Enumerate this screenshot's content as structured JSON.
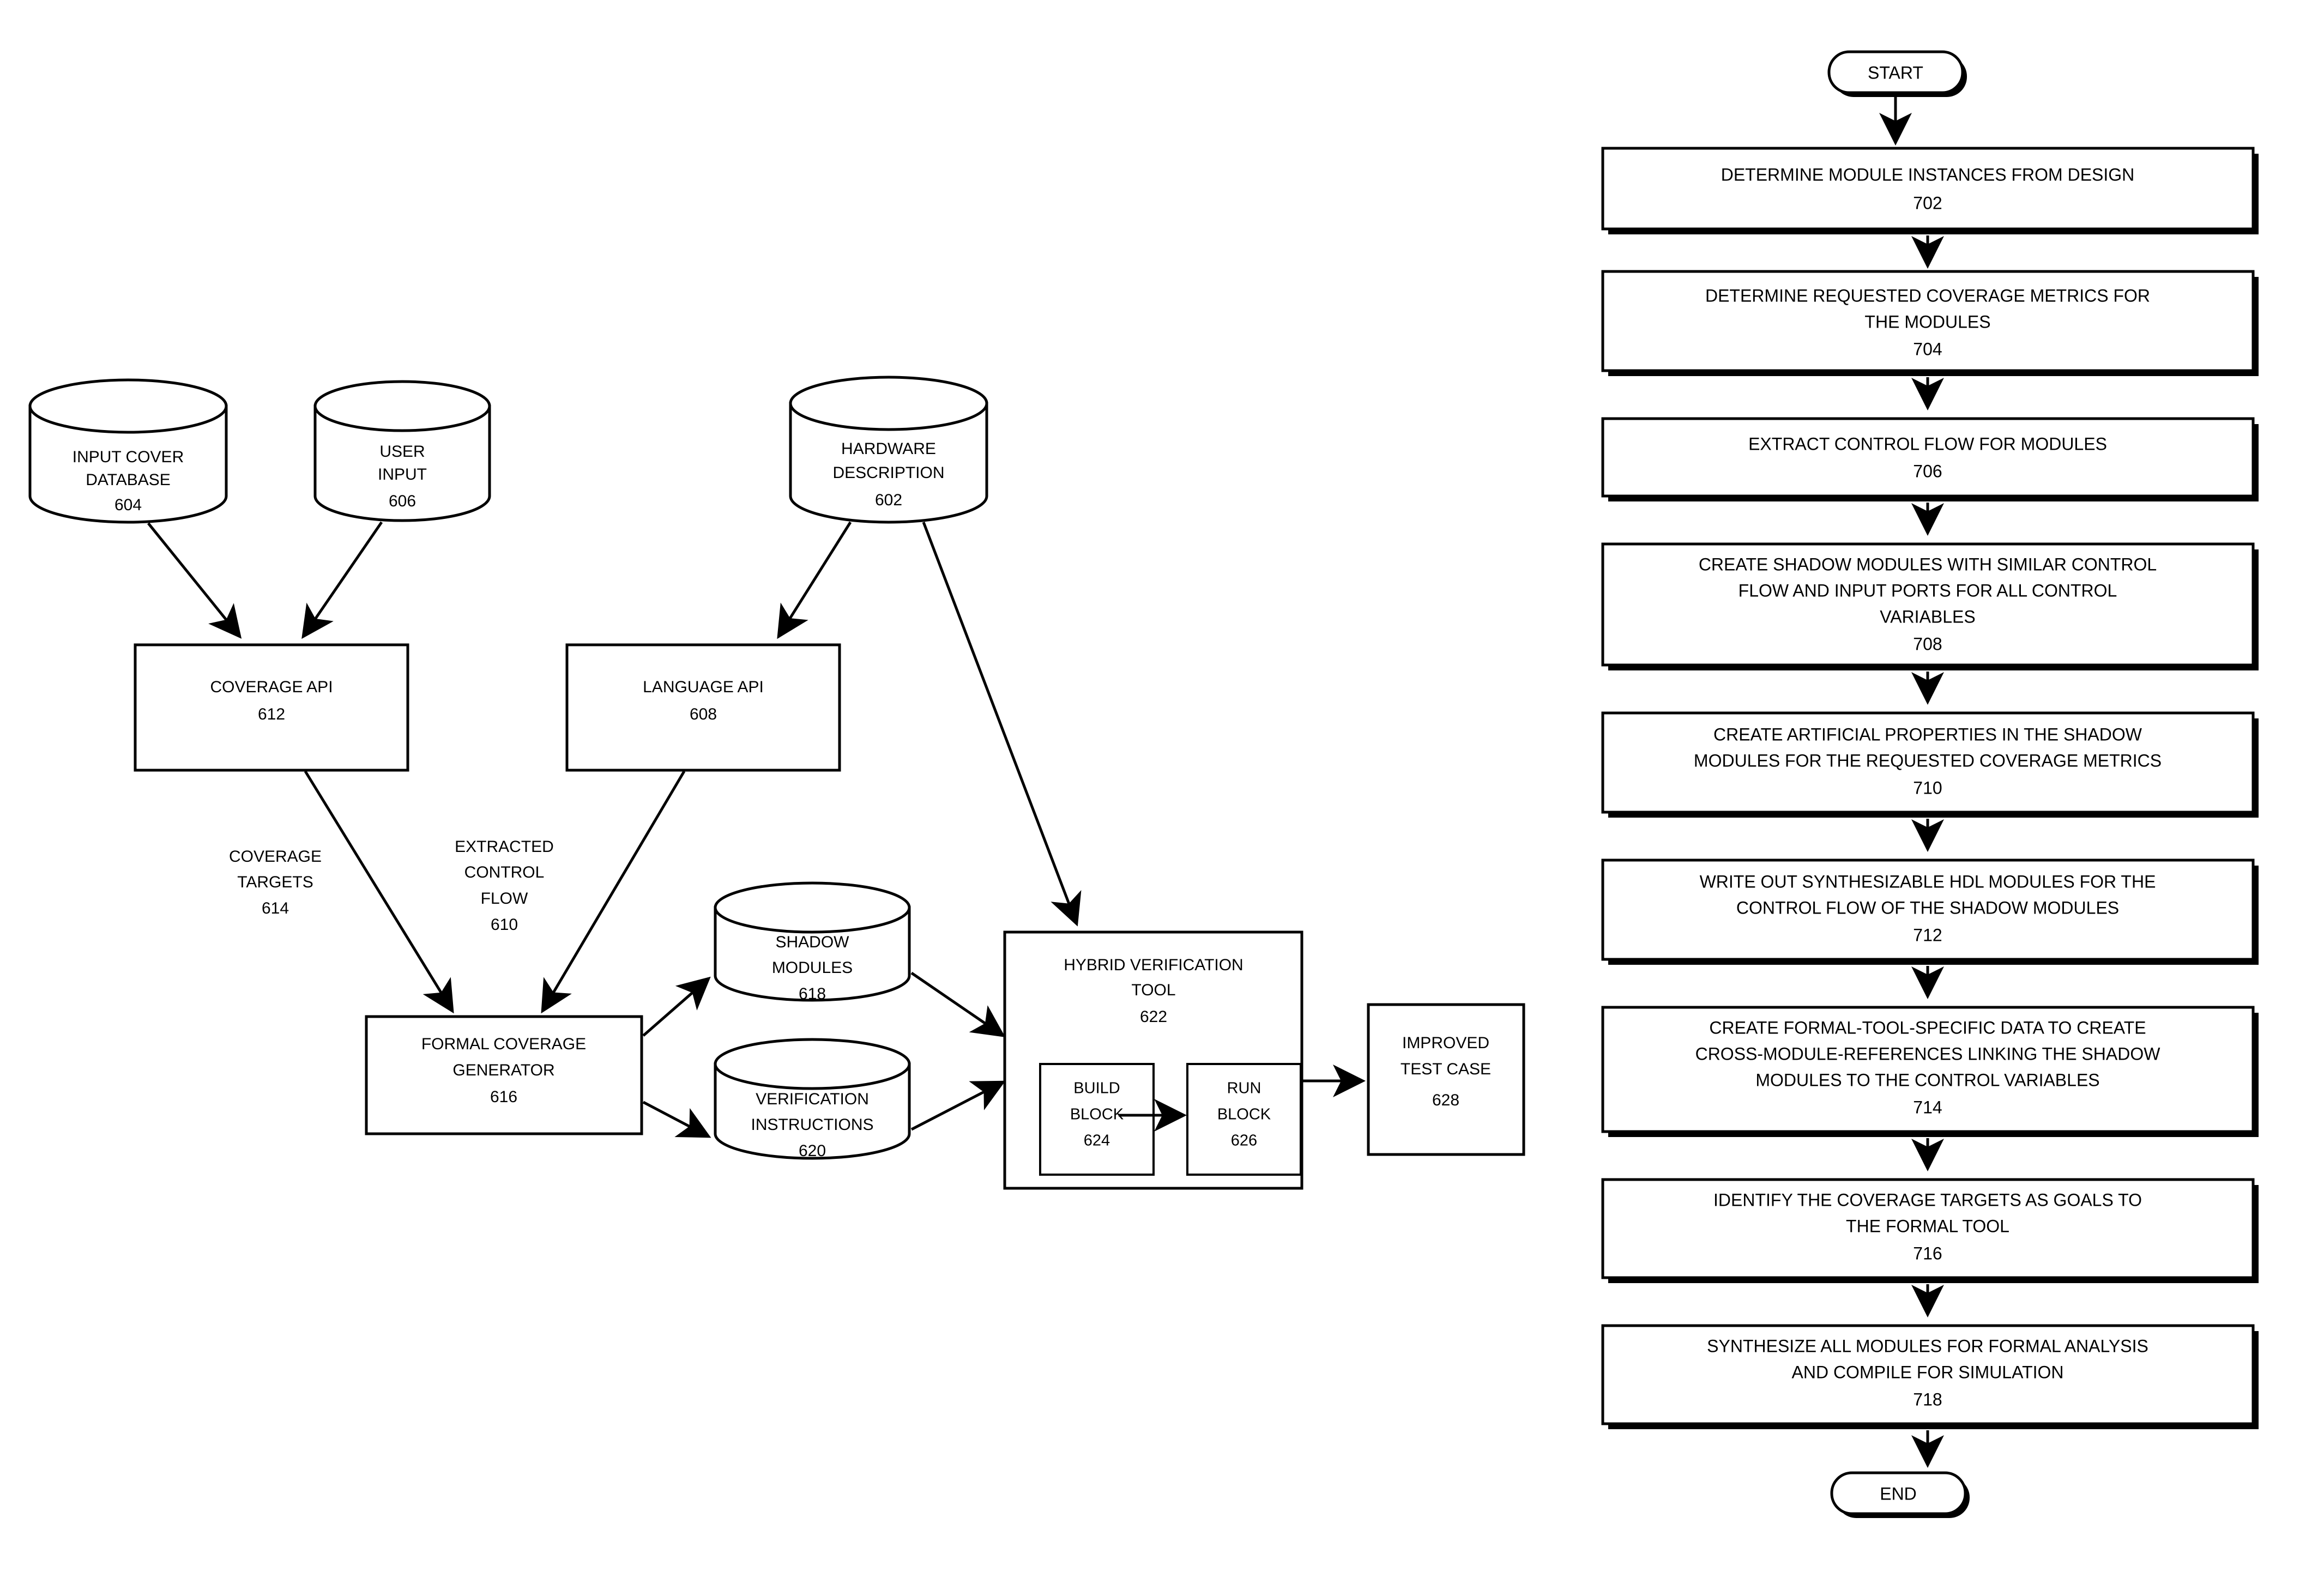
{
  "figure_left": {
    "name": "system-block-diagram",
    "nodes": [
      {
        "id": "604",
        "kind": "cylinder",
        "lines": [
          "INPUT COVER",
          "DATABASE"
        ],
        "ref": "604"
      },
      {
        "id": "606",
        "kind": "cylinder",
        "lines": [
          "USER",
          "INPUT"
        ],
        "ref": "606"
      },
      {
        "id": "602",
        "kind": "cylinder",
        "lines": [
          "HARDWARE",
          "DESCRIPTION"
        ],
        "ref": "602"
      },
      {
        "id": "612",
        "kind": "box",
        "lines": [
          "COVERAGE API"
        ],
        "ref": "612"
      },
      {
        "id": "608",
        "kind": "box",
        "lines": [
          "LANGUAGE API"
        ],
        "ref": "608"
      },
      {
        "id": "616",
        "kind": "box",
        "lines": [
          "FORMAL COVERAGE",
          "GENERATOR"
        ],
        "ref": "616"
      },
      {
        "id": "618",
        "kind": "cylinder",
        "lines": [
          "SHADOW",
          "MODULES"
        ],
        "ref": "618"
      },
      {
        "id": "620",
        "kind": "cylinder",
        "lines": [
          "VERIFICATION",
          "INSTRUCTIONS"
        ],
        "ref": "620"
      },
      {
        "id": "622",
        "kind": "box",
        "lines": [
          "HYBRID VERIFICATION",
          "TOOL"
        ],
        "ref": "622"
      },
      {
        "id": "624",
        "kind": "box",
        "lines": [
          "BUILD",
          "BLOCK"
        ],
        "ref": "624"
      },
      {
        "id": "626",
        "kind": "box",
        "lines": [
          "RUN",
          "BLOCK"
        ],
        "ref": "626"
      },
      {
        "id": "628",
        "kind": "box",
        "lines": [
          "IMPROVED",
          "TEST CASE"
        ],
        "ref": "628"
      }
    ],
    "edge_labels": [
      {
        "id": "614",
        "lines": [
          "COVERAGE",
          "TARGETS"
        ],
        "ref": "614"
      },
      {
        "id": "610",
        "lines": [
          "EXTRACTED",
          "CONTROL",
          "FLOW"
        ],
        "ref": "610"
      }
    ]
  },
  "figure_right": {
    "name": "process-flowchart",
    "start_label": "START",
    "end_label": "END",
    "steps": [
      {
        "ref": "702",
        "lines": [
          "DETERMINE MODULE INSTANCES FROM DESIGN"
        ]
      },
      {
        "ref": "704",
        "lines": [
          "DETERMINE REQUESTED COVERAGE METRICS FOR",
          "THE MODULES"
        ]
      },
      {
        "ref": "706",
        "lines": [
          "EXTRACT CONTROL FLOW FOR MODULES"
        ]
      },
      {
        "ref": "708",
        "lines": [
          "CREATE SHADOW  MODULES WITH SIMILAR CONTROL",
          "FLOW AND INPUT PORTS FOR ALL CONTROL",
          "VARIABLES"
        ]
      },
      {
        "ref": "710",
        "lines": [
          "CREATE ARTIFICIAL PROPERTIES IN THE SHADOW",
          "MODULES FOR THE REQUESTED COVERAGE METRICS"
        ]
      },
      {
        "ref": "712",
        "lines": [
          "WRITE OUT SYNTHESIZABLE HDL MODULES FOR THE",
          "CONTROL FLOW OF THE SHADOW MODULES"
        ]
      },
      {
        "ref": "714",
        "lines": [
          "CREATE FORMAL-TOOL-SPECIFIC DATA TO CREATE",
          "CROSS-MODULE-REFERENCES LINKING THE SHADOW",
          "MODULES TO THE CONTROL VARIABLES"
        ]
      },
      {
        "ref": "716",
        "lines": [
          "IDENTIFY THE COVERAGE TARGETS AS GOALS TO",
          "THE FORMAL TOOL"
        ]
      },
      {
        "ref": "718",
        "lines": [
          "SYNTHESIZE ALL MODULES FOR FORMAL ANALYSIS",
          "AND COMPILE FOR SIMULATION"
        ]
      }
    ]
  },
  "colors": {
    "ink": "#000000",
    "paper": "#ffffff"
  }
}
